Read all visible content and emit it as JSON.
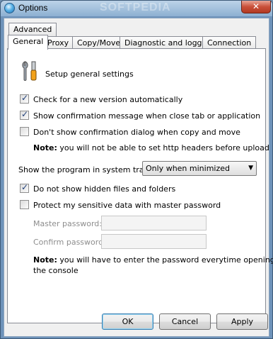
{
  "window": {
    "title": "Options",
    "watermark": "SOFTPEDIA",
    "close_glyph": "✕"
  },
  "tabs_row1": [
    {
      "label": "Advanced"
    }
  ],
  "tabs_row2": [
    {
      "label": "General",
      "active": true
    },
    {
      "label": "Proxy"
    },
    {
      "label": "Copy/Move"
    },
    {
      "label": "Diagnostic and logging"
    },
    {
      "label": "Connection"
    }
  ],
  "general": {
    "header": "Setup general settings",
    "header_icon": "tools-icon",
    "check_new_version": {
      "label": "Check for a new version automatically",
      "checked": true
    },
    "show_confirmation": {
      "label": "Show confirmation message when close tab or application",
      "checked": true
    },
    "dont_show_copy_move": {
      "label": "Don't show confirmation dialog when copy and move",
      "checked": false
    },
    "note1_bold": "Note:",
    "note1_text": "you will not be able to set http headers before upload",
    "tray_label": "Show the program in system tray:",
    "tray_value": "Only when minimized",
    "hidden_files": {
      "label": "Do not show hidden files and folders",
      "checked": true
    },
    "protect": {
      "label": "Protect my sensitive data with master password",
      "checked": false
    },
    "master_password_label": "Master password:",
    "confirm_password_label": "Confirm password:",
    "master_password_value": "",
    "confirm_password_value": "",
    "note2_bold": "Note:",
    "note2_line1": "you will have to enter the password everytime opening",
    "note2_line2": "the console"
  },
  "buttons": {
    "ok": "OK",
    "cancel": "Cancel",
    "apply": "Apply"
  }
}
